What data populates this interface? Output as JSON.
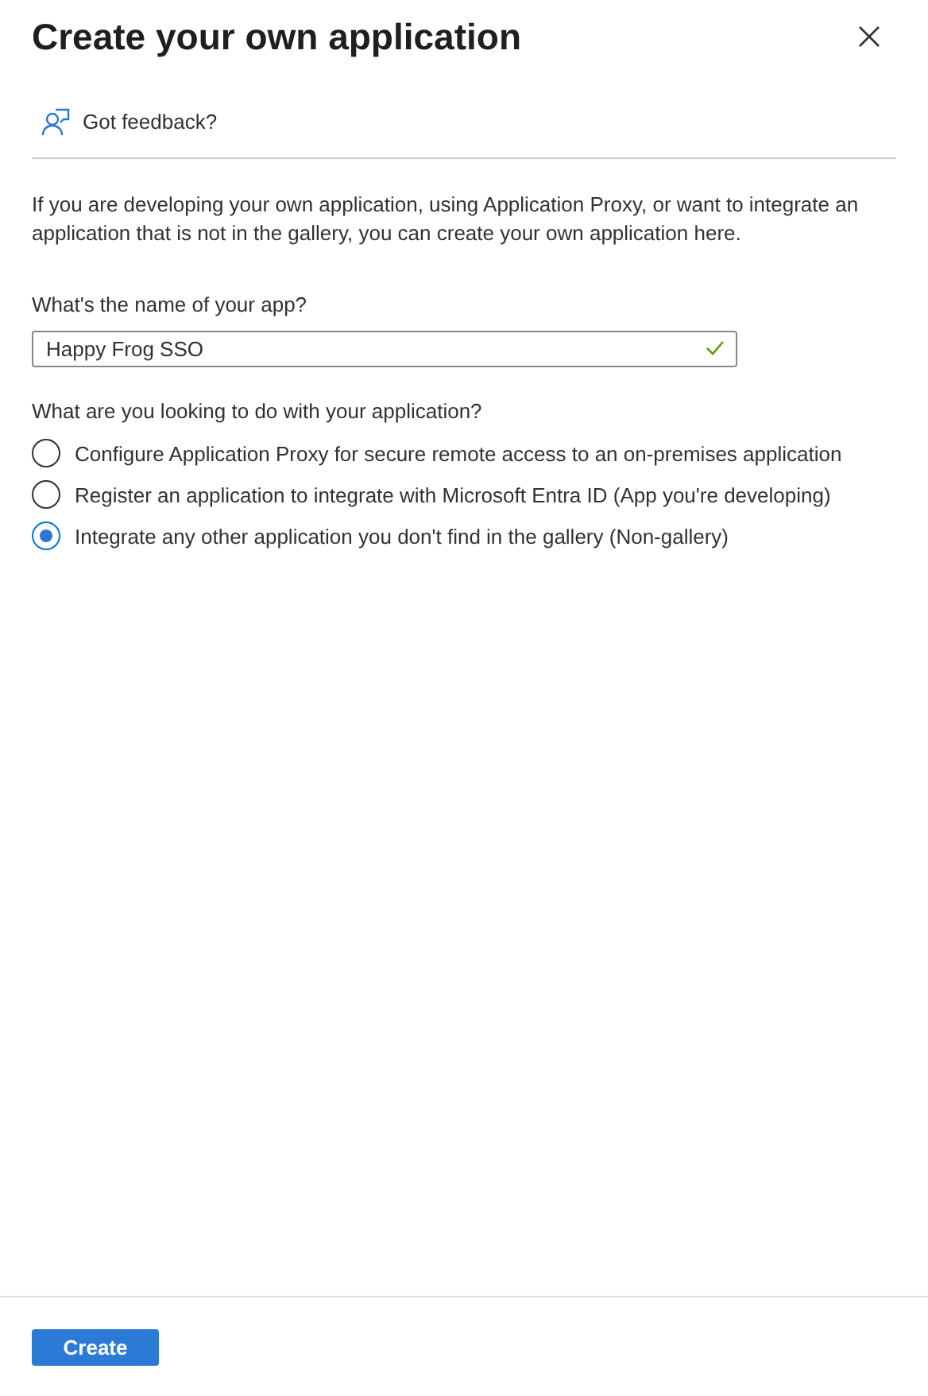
{
  "panel": {
    "title": "Create your own application"
  },
  "feedback": {
    "label": "Got feedback?"
  },
  "description": "If you are developing your own application, using Application Proxy, or want to integrate an application that is not in the gallery, you can create your own application here.",
  "name_field": {
    "label": "What's the name of your app?",
    "value": "Happy Frog SSO",
    "valid": true
  },
  "purpose": {
    "question": "What are you looking to do with your application?",
    "options": [
      {
        "label": "Configure Application Proxy for secure remote access to an on-premises application",
        "selected": false
      },
      {
        "label": "Register an application to integrate with Microsoft Entra ID (App you're developing)",
        "selected": false
      },
      {
        "label": "Integrate any other application you don't find in the gallery (Non-gallery)",
        "selected": true
      }
    ]
  },
  "buttons": [
    {
      "label": "Create",
      "kind": "primary"
    }
  ]
}
